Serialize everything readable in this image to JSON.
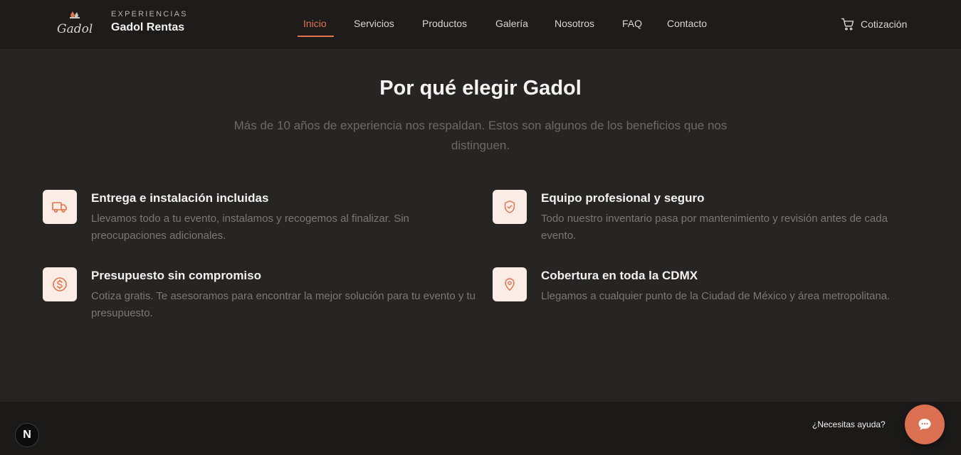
{
  "header": {
    "brand_kicker": "EXPERIENCIAS",
    "brand_name": "Gadol Rentas",
    "logo_text": "Gadol",
    "nav": [
      {
        "label": "Inicio",
        "active": true
      },
      {
        "label": "Servicios"
      },
      {
        "label": "Productos"
      },
      {
        "label": "Galería"
      },
      {
        "label": "Nosotros"
      },
      {
        "label": "FAQ"
      },
      {
        "label": "Contacto"
      }
    ],
    "quote_label": "Cotización",
    "quote_icon": "cart-icon"
  },
  "main": {
    "title": "Por qué elegir Gadol",
    "subtitle": "Más de 10 años de experiencia nos respaldan. Estos son algunos de los beneficios que nos distinguen.",
    "features": [
      {
        "icon": "truck-icon",
        "title": "Entrega e instalación incluidas",
        "desc": "Llevamos todo a tu evento, instalamos y recogemos al finalizar. Sin preocupaciones adicionales."
      },
      {
        "icon": "shield-icon",
        "title": "Equipo profesional y seguro",
        "desc": "Todo nuestro inventario pasa por mantenimiento y revisión antes de cada evento."
      },
      {
        "icon": "dollar-icon",
        "title": "Presupuesto sin compromiso",
        "desc": "Cotiza gratis. Te asesoramos para encontrar la mejor solución para tu evento y tu presupuesto."
      },
      {
        "icon": "map-pin-icon",
        "title": "Cobertura en toda la CDMX",
        "desc": "Llegamos a cualquier punto de la Ciudad de México y área metropolitana."
      }
    ]
  },
  "footer": {
    "badge_letter": "N",
    "help_text": "¿Necesitas ayuda?",
    "chat_icon": "chat-bubble-icon"
  },
  "colors": {
    "accent": "#e0754f",
    "icon_bg": "#fbece5",
    "background": "#262524",
    "header_bg": "#1d1c1b"
  }
}
